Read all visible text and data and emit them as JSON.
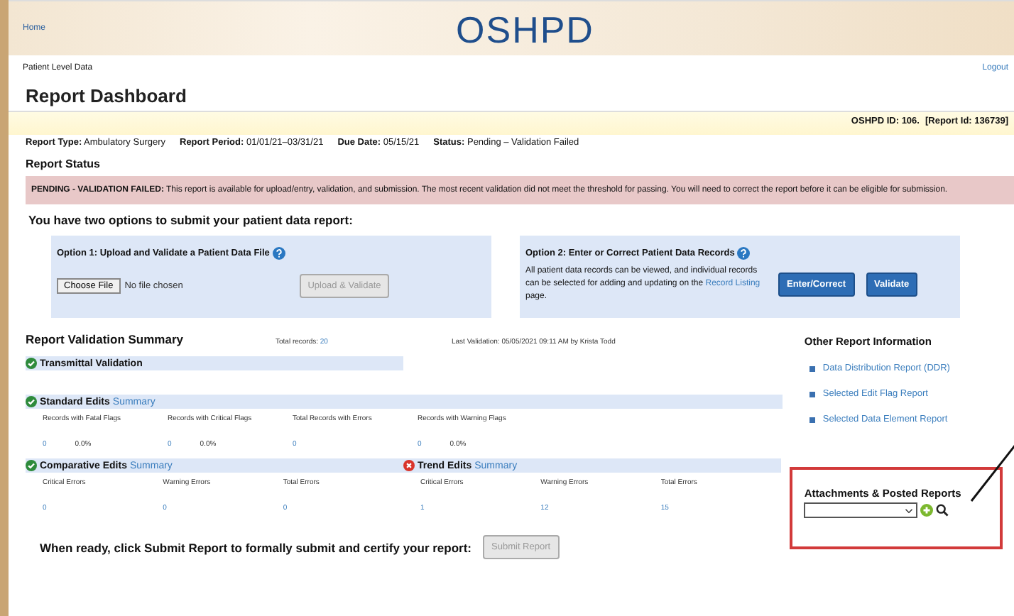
{
  "header": {
    "home_link": "Home",
    "logo": "OSHPD"
  },
  "subheader": {
    "section": "Patient Level Data",
    "logout": "Logout"
  },
  "page_title": "Report Dashboard",
  "ids": {
    "oshpd_id": "OSHPD ID: 106.",
    "report_id": "[Report Id: 136739]"
  },
  "report_meta": [
    {
      "label": "Report Type:",
      "value": "Ambulatory Surgery"
    },
    {
      "label": "Report Period:",
      "value": "01/01/21–03/31/21"
    },
    {
      "label": "Due Date:",
      "value": "05/15/21"
    },
    {
      "label": "Status:",
      "value": "Pending – Validation Failed"
    }
  ],
  "report_status": {
    "heading": "Report Status",
    "alert": "**PENDING - VALIDATION FAILED:** This report is available for upload/entry, validation, and submission. The most recent validation did not meet the threshold for passing. You will need to correct the report before it can be eligible for submission."
  },
  "options_heading": "You have two options to submit your patient data report:",
  "option1": {
    "title": "Option 1: Upload and Validate a Patient Data File",
    "choose_file": "Choose File",
    "no_file": "No file chosen",
    "upload_button": {
      "label": "Upload & Validate",
      "disabled": true
    }
  },
  "option2": {
    "title": "Option 2: Enter or Correct Patient Data Records",
    "text_before": "All patient data records can be viewed, and individual records can be selected for adding and updating on the",
    "link": "Record Listing",
    "text_after": "page.",
    "buttons": [
      "Enter/Correct",
      "Validate"
    ]
  },
  "summary": {
    "title": "Report Validation Summary",
    "total_label": "Total records:",
    "total_value": "20",
    "last_validation": "Last Validation: 05/05/2021 09:11 AM by Krista Todd",
    "rows": [
      [
        {
          "title": "Transmittal Validation",
          "passed": true
        }
      ],
      [
        {
          "title": "Standard Edits",
          "passed": true,
          "link": "Summary",
          "metrics": [
            {
              "label": "Records with Fatal Flags",
              "value": "0",
              "percent": "0.0%"
            },
            {
              "label": "Records with Critical Flags",
              "value": "0",
              "percent": "0.0%"
            },
            {
              "label": "Total Records with Errors",
              "value": "0"
            },
            {
              "label": "Records with Warning Flags",
              "value": "0",
              "percent": "0.0%"
            }
          ]
        }
      ],
      [
        {
          "title": "Comparative Edits",
          "passed": true,
          "link": "Summary",
          "metrics": [
            {
              "label": "Critical Errors",
              "value": "0"
            },
            {
              "label": "Warning Errors",
              "value": "0"
            },
            {
              "label": "Total Errors",
              "value": "0"
            }
          ]
        },
        {
          "title": "Trend Edits",
          "passed": false,
          "link": "Summary",
          "metrics": [
            {
              "label": "Critical Errors",
              "value": "1"
            },
            {
              "label": "Warning Errors",
              "value": "12"
            },
            {
              "label": "Total Errors",
              "value": "15"
            }
          ]
        }
      ]
    ]
  },
  "submit": {
    "text": "When ready, click Submit Report to formally submit and certify your report:",
    "button": {
      "label": "Submit Report",
      "disabled": true
    }
  },
  "other_info": {
    "title": "Other Report Information",
    "links": [
      "Data Distribution Report (DDR)",
      "Selected Edit Flag Report",
      "Selected Data Element Report"
    ]
  },
  "attachments": {
    "title": "Attachments & Posted Reports"
  }
}
